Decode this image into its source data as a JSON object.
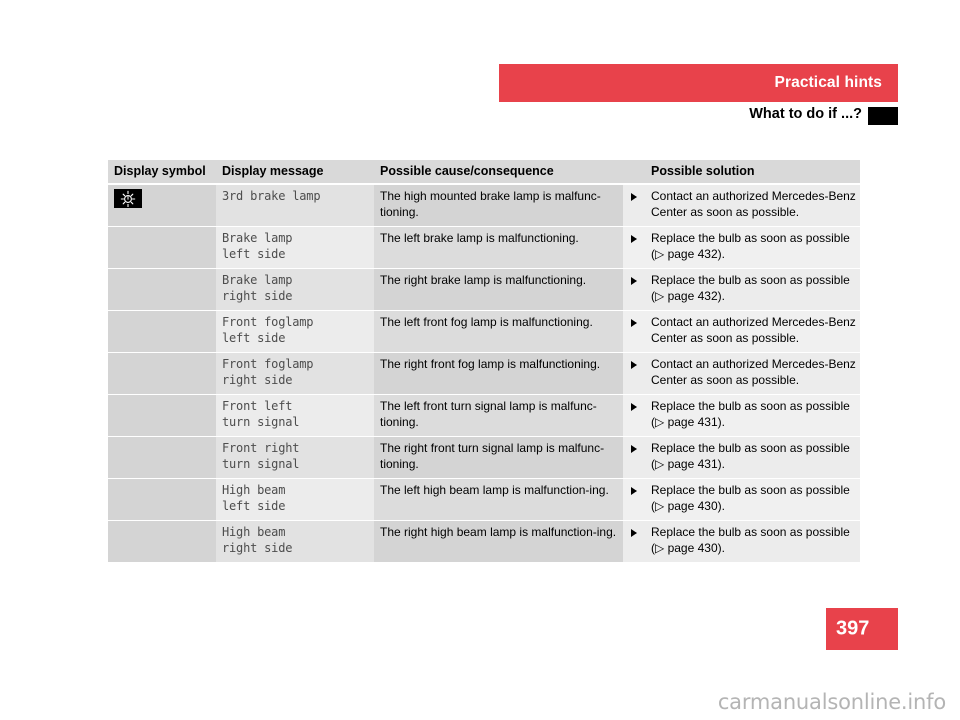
{
  "header": {
    "section_title": "Practical hints",
    "subsection_title": "What to do if ...?",
    "accent_color": "#e8424b",
    "marker_color": "#000000"
  },
  "table": {
    "columns": [
      {
        "key": "symbol",
        "label": "Display symbol"
      },
      {
        "key": "message",
        "label": "Display message"
      },
      {
        "key": "cause",
        "label": "Possible cause/consequence"
      },
      {
        "key": "solution",
        "label": "Possible solution"
      }
    ],
    "rows": [
      {
        "symbol_icon": "lamp-icon",
        "message": "3rd brake lamp",
        "cause": "The high mounted brake lamp is malfunc-tioning.",
        "bullet": "▶",
        "solution_line1": "Contact an authorized Mercedes-Benz",
        "solution_line2": "Center as soon as possible."
      },
      {
        "symbol_icon": "",
        "message": "Brake lamp\nleft side",
        "cause": "The left brake lamp is malfunctioning.",
        "bullet": "▶",
        "solution_line1": "Replace the bulb as soon as possible",
        "solution_line2": "(▷ page 432)."
      },
      {
        "symbol_icon": "",
        "message": "Brake lamp\nright side",
        "cause": "The right brake lamp is malfunctioning.",
        "bullet": "▶",
        "solution_line1": "Replace the bulb as soon as possible",
        "solution_line2": "(▷ page 432)."
      },
      {
        "symbol_icon": "",
        "message": "Front foglamp\nleft side",
        "cause": "The left front fog lamp is malfunctioning.",
        "bullet": "▶",
        "solution_line1": "Contact an authorized Mercedes-Benz",
        "solution_line2": "Center as soon as possible."
      },
      {
        "symbol_icon": "",
        "message": "Front foglamp\nright side",
        "cause": "The right front fog lamp is malfunctioning.",
        "bullet": "▶",
        "solution_line1": "Contact an authorized Mercedes-Benz",
        "solution_line2": "Center as soon as possible."
      },
      {
        "symbol_icon": "",
        "message": "Front left\nturn signal",
        "cause": "The left front turn signal lamp is malfunc-tioning.",
        "bullet": "▶",
        "solution_line1": "Replace the bulb as soon as possible",
        "solution_line2": "(▷ page 431)."
      },
      {
        "symbol_icon": "",
        "message": "Front right\nturn signal",
        "cause": "The right front turn signal lamp is malfunc-tioning.",
        "bullet": "▶",
        "solution_line1": "Replace the bulb as soon as possible",
        "solution_line2": "(▷ page 431)."
      },
      {
        "symbol_icon": "",
        "message": "High beam\nleft side",
        "cause": "The left high beam lamp is malfunction-ing.",
        "bullet": "▶",
        "solution_line1": "Replace the bulb as soon as possible",
        "solution_line2": "(▷ page 430)."
      },
      {
        "symbol_icon": "",
        "message": "High beam\nright side",
        "cause": "The right high beam lamp is malfunction-ing.",
        "bullet": "▶",
        "solution_line1": "Replace the bulb as soon as possible",
        "solution_line2": "(▷ page 430)."
      }
    ]
  },
  "footer": {
    "page_number": "397",
    "watermark": "carmanualsonline.info"
  }
}
